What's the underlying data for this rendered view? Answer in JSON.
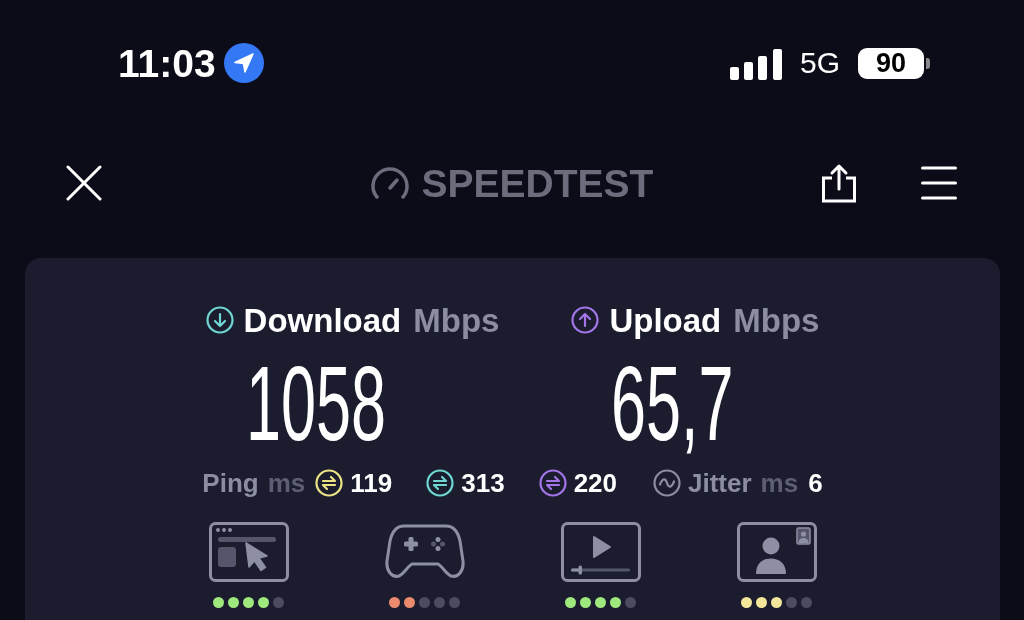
{
  "status_bar": {
    "time": "11:03",
    "network": "5G",
    "battery": "90"
  },
  "header": {
    "logo": "SPEEDTEST"
  },
  "speeds": [
    {
      "kind": "download",
      "label": "Download",
      "unit": "Mbps",
      "value": "1058",
      "color": "#6fd6d2"
    },
    {
      "kind": "upload",
      "label": "Upload",
      "unit": "Mbps",
      "value": "65,7",
      "color": "#a375e8"
    }
  ],
  "ping": {
    "label": "Ping",
    "unit": "ms",
    "readings": [
      {
        "value": "119",
        "color": "#ece386"
      },
      {
        "value": "313",
        "color": "#6fd6d2"
      },
      {
        "value": "220",
        "color": "#a375e8"
      }
    ]
  },
  "jitter": {
    "label": "Jitter",
    "unit": "ms",
    "value": "6"
  },
  "categories": [
    {
      "kind": "browsing",
      "stars": 4,
      "color": "#9fe87e"
    },
    {
      "kind": "gaming",
      "stars": 2,
      "color": "#ec8a6e"
    },
    {
      "kind": "streaming",
      "stars": 4,
      "color": "#9fe87e"
    },
    {
      "kind": "videochat",
      "stars": 3,
      "color": "#f4e79c"
    }
  ]
}
